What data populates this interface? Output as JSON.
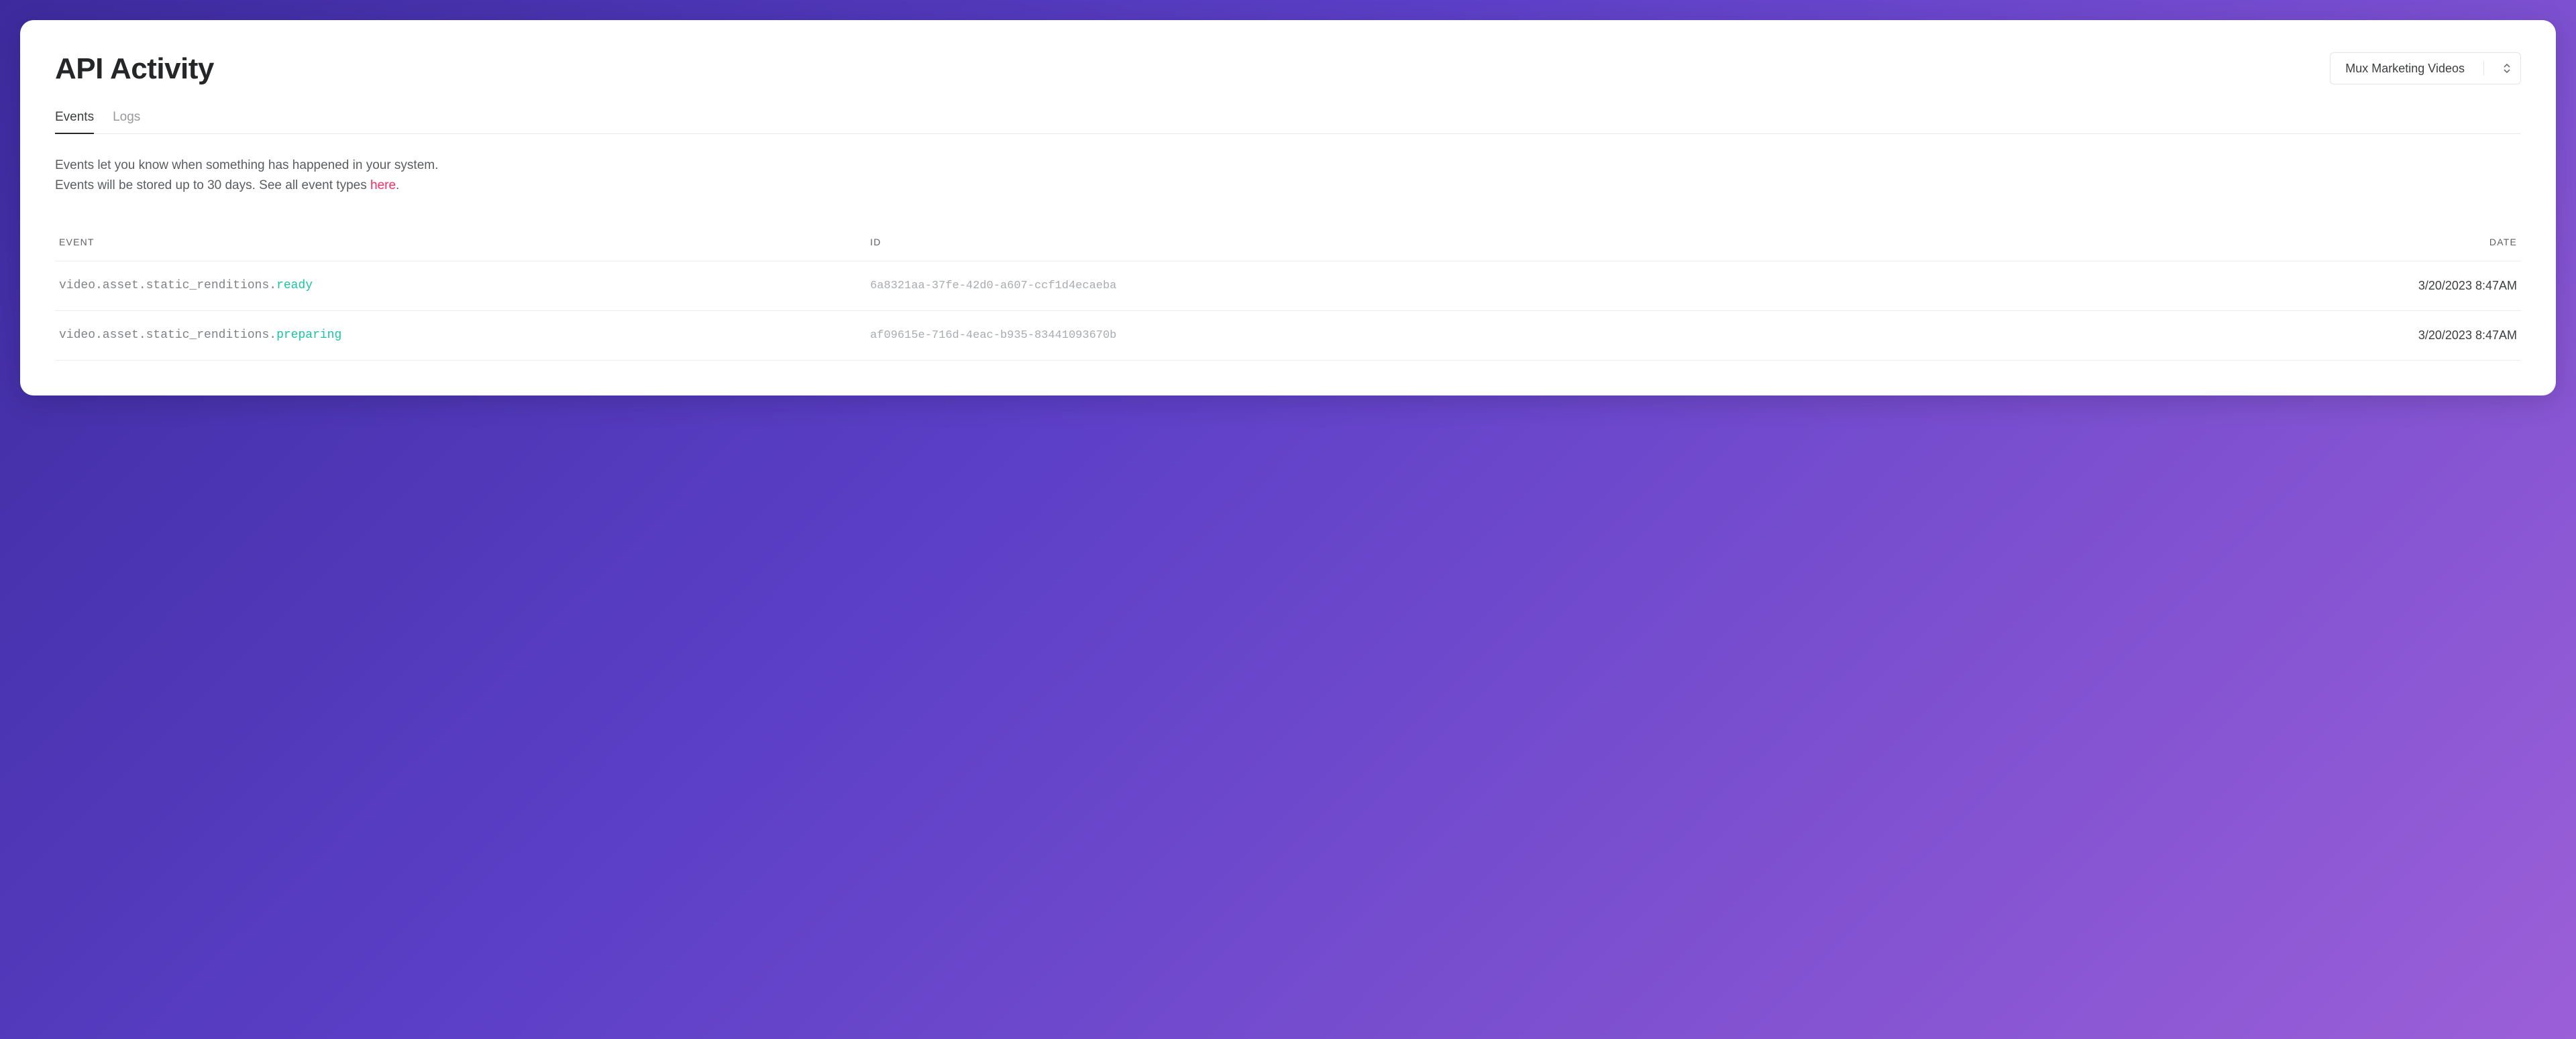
{
  "header": {
    "title": "API Activity",
    "environment": "Mux Marketing Videos"
  },
  "tabs": [
    {
      "label": "Events",
      "active": true
    },
    {
      "label": "Logs",
      "active": false
    }
  ],
  "description": {
    "line1": "Events let you know when something has happened in your system.",
    "line2_prefix": "Events will be stored up to 30 days. See all event types ",
    "link_text": "here",
    "line2_suffix": "."
  },
  "table": {
    "columns": {
      "event": "EVENT",
      "id": "ID",
      "date": "DATE"
    },
    "rows": [
      {
        "event_prefix": "video.asset.static_renditions.",
        "event_status": "ready",
        "id": "6a8321aa-37fe-42d0-a607-ccf1d4ecaeba",
        "date": "3/20/2023 8:47AM"
      },
      {
        "event_prefix": "video.asset.static_renditions.",
        "event_status": "preparing",
        "id": "af09615e-716d-4eac-b935-83441093670b",
        "date": "3/20/2023 8:47AM"
      }
    ]
  }
}
